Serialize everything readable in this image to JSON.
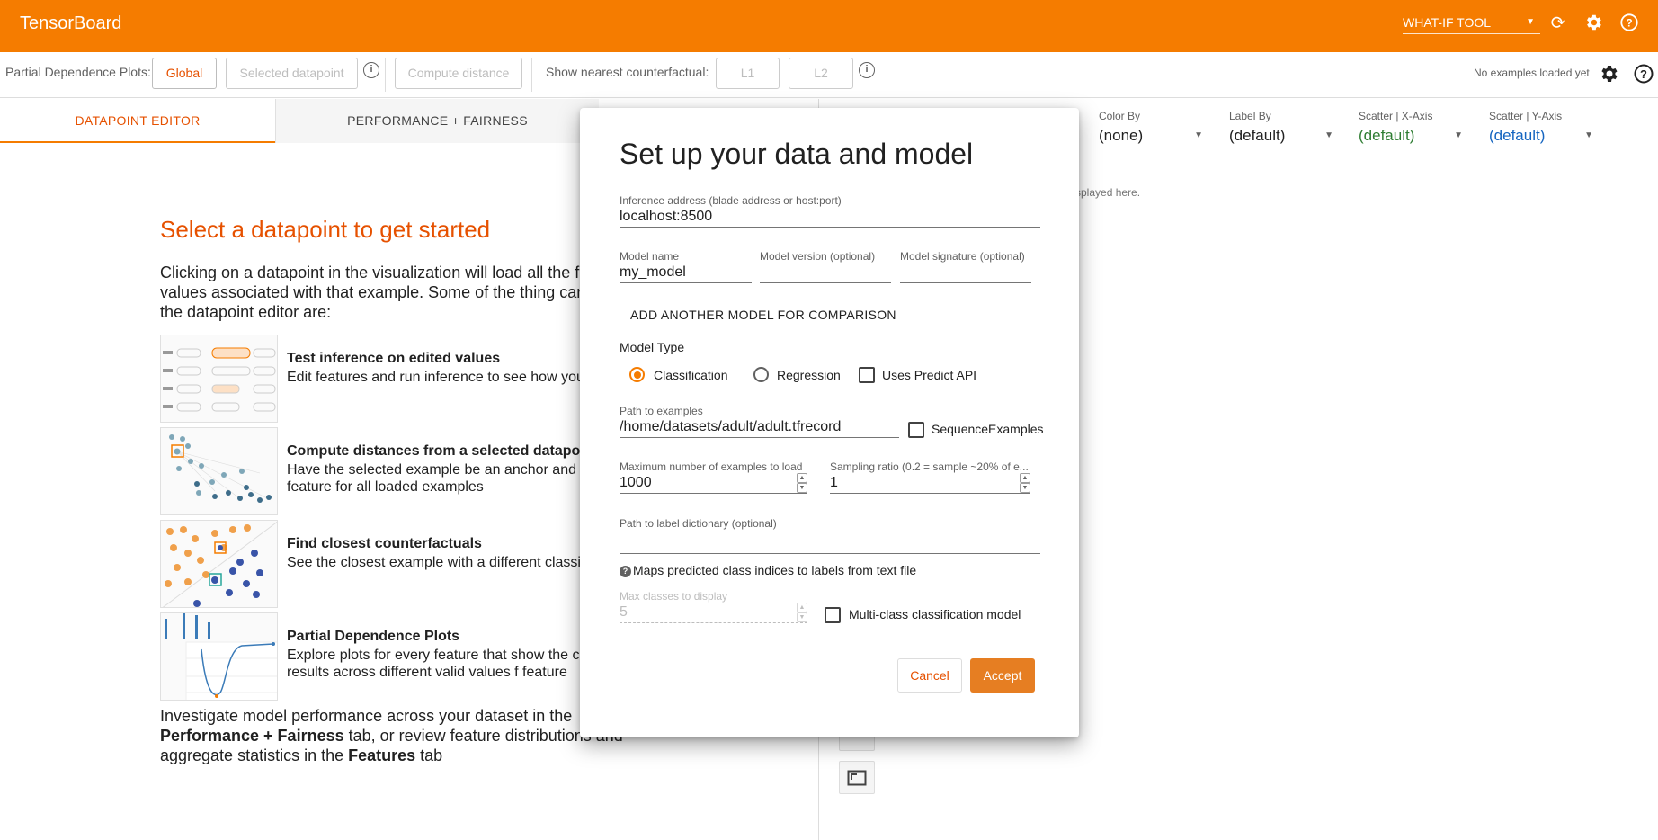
{
  "app": {
    "title": "TensorBoard",
    "tool_select": "WHAT-IF TOOL",
    "brand_color": "#f57c00"
  },
  "toolbar": {
    "pdp_label": "Partial Dependence Plots:",
    "global_btn": "Global",
    "selected_dp_btn": "Selected datapoint",
    "compute_distance_btn": "Compute distance",
    "nearest_cf_label": "Show nearest counterfactual:",
    "l1_btn": "L1",
    "l2_btn": "L2",
    "status": "No examples loaded yet"
  },
  "tabs": [
    {
      "label": "DATAPOINT EDITOR",
      "active": true
    },
    {
      "label": "PERFORMANCE + FAIRNESS",
      "active": false
    }
  ],
  "editor": {
    "heading": "Select a datapoint to get started",
    "intro": "Clicking on a datapoint in the visualization will load all the fe and values associated with that example. Some of the thing can do in the datapoint editor are:",
    "features": [
      {
        "title": "Test inference on edited values",
        "desc": "Edit features and run inference to see how you performs"
      },
      {
        "title": "Compute distances from a selected datapoint",
        "desc": "Have the selected example be an anchor and c distance feature for all loaded examples"
      },
      {
        "title": "Find closest counterfactuals",
        "desc": "See the closest example with a different classi"
      },
      {
        "title": "Partial Dependence Plots",
        "desc": "Explore plots for every feature that show the ch inference results across different valid values f feature"
      }
    ],
    "outro_1": "Investigate model performance across your dataset in the",
    "outro_bold_1": "Performance + Fairness",
    "outro_2": " tab, or review feature distributions and aggregate statistics in the ",
    "outro_bold_2": "Features",
    "outro_3": " tab"
  },
  "right": {
    "color_by": {
      "label": "Color By",
      "value": "(none)"
    },
    "label_by": {
      "label": "Label By",
      "value": "(default)"
    },
    "scatter_x": {
      "label": "Scatter | X-Axis",
      "value": "(default)"
    },
    "scatter_y": {
      "label": "Scatter | Y-Axis",
      "value": "(default)"
    },
    "partial_text": "splayed here.",
    "green": "#2e7d32",
    "blue": "#1565c0"
  },
  "dialog": {
    "title": "Set up your data and model",
    "inference_address": {
      "label": "Inference address (blade address or host:port)",
      "value": "localhost:8500"
    },
    "model_name": {
      "label": "Model name",
      "value": "my_model"
    },
    "model_version": {
      "label": "Model version (optional)",
      "value": ""
    },
    "model_signature": {
      "label": "Model signature (optional)",
      "value": ""
    },
    "add_model": "ADD ANOTHER MODEL FOR COMPARISON",
    "model_type_label": "Model Type",
    "classification": "Classification",
    "regression": "Regression",
    "uses_predict_api": "Uses Predict API",
    "path_examples": {
      "label": "Path to examples",
      "value": "/home/datasets/adult/adult.tfrecord"
    },
    "sequence_examples": "SequenceExamples",
    "max_examples": {
      "label": "Maximum number of examples to load",
      "value": "1000"
    },
    "sampling_ratio": {
      "label": "Sampling ratio (0.2 = sample ~20% of e...",
      "value": "1"
    },
    "label_dict": {
      "label": "Path to label dictionary (optional)",
      "value": ""
    },
    "label_dict_help": "Maps predicted class indices to labels from text file",
    "max_classes": {
      "label": "Max classes to display",
      "value": "5"
    },
    "multiclass": "Multi-class classification model",
    "cancel": "Cancel",
    "accept": "Accept"
  }
}
